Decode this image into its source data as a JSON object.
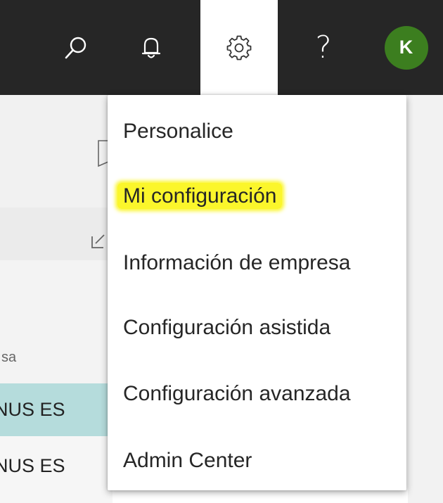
{
  "header": {
    "icons": [
      "search-icon",
      "bell-icon",
      "gear-icon",
      "help-icon"
    ],
    "help_glyph": "?",
    "avatar_initial": "K",
    "avatar_color": "#3c7e1f",
    "background_color": "#262626"
  },
  "background": {
    "column_label": "sa",
    "rows": [
      {
        "text": "NUS ES",
        "highlighted": true
      },
      {
        "text": "NUS ES",
        "highlighted": false
      }
    ],
    "highlight_color": "#b5dcdc"
  },
  "settings_menu": {
    "items": [
      {
        "label": "Personalice",
        "highlighted": false
      },
      {
        "label": "Mi configuración",
        "highlighted": true
      },
      {
        "label": "Información de empresa",
        "highlighted": false
      },
      {
        "label": "Configuración asistida",
        "highlighted": false
      },
      {
        "label": "Configuración avanzada",
        "highlighted": false
      },
      {
        "label": "Admin Center",
        "highlighted": false
      }
    ],
    "highlight_color": "#fbf62b"
  }
}
